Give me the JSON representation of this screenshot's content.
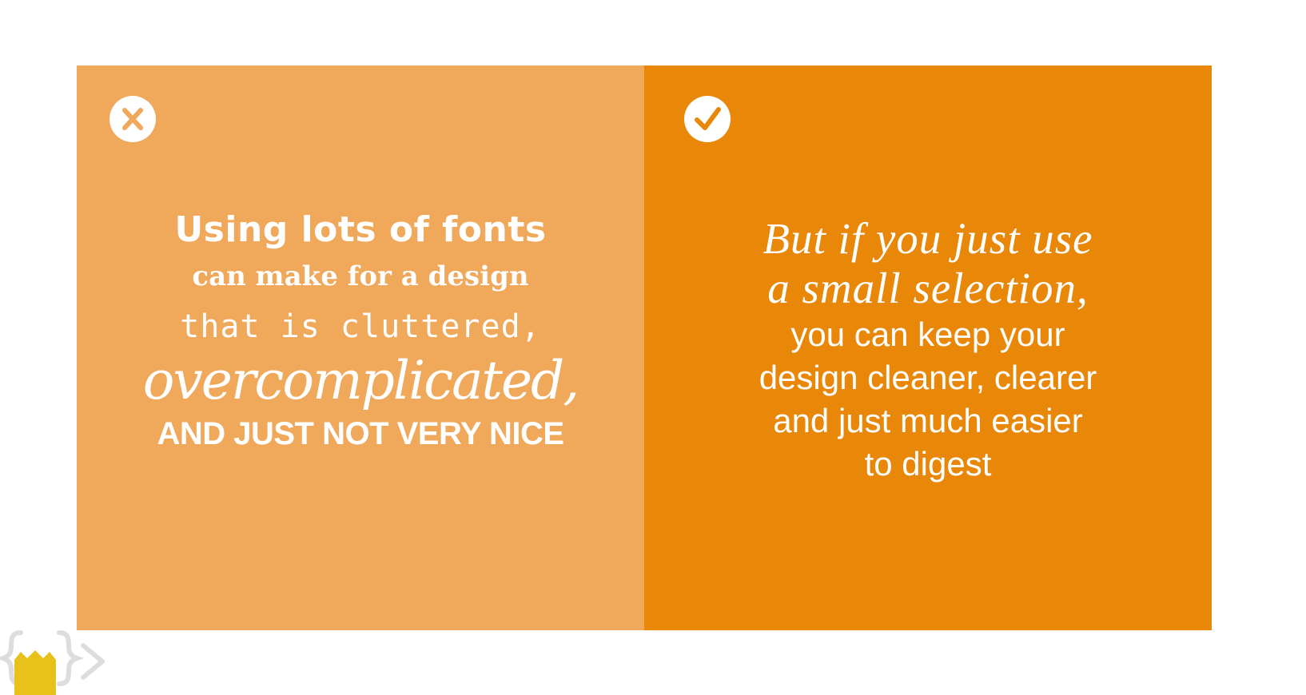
{
  "left_panel": {
    "icon": "cross-icon",
    "color": "#f0a85a",
    "lines": [
      "Using lots of fonts",
      "can make for a design",
      "that is cluttered,",
      "overcomplicated,",
      "AND JUST NOT VERY NICE"
    ]
  },
  "right_panel": {
    "icon": "checkmark-icon",
    "color": "#e98708",
    "lines": [
      "But if you just use",
      "a small selection,",
      "you can keep your",
      "design cleaner, clearer",
      "and just much easier",
      "to digest"
    ]
  },
  "logo": {
    "icon": "curly-brace-logo-icon",
    "accent": "#e8c21a"
  }
}
